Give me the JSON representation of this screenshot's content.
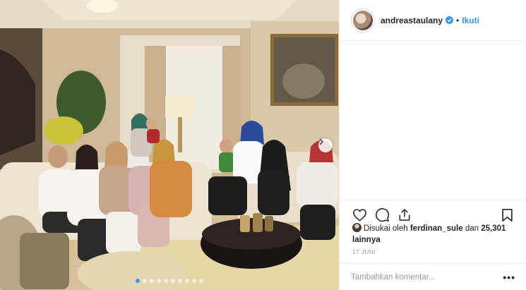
{
  "post": {
    "photo_alt": "Family gathering in living room",
    "carousel": {
      "count": 10,
      "active_index": 0
    }
  },
  "header": {
    "username": "andreastaulany",
    "separator": "•",
    "follow_label": "Ikuti",
    "verified_icon": "verified-badge-icon"
  },
  "actions": {
    "like_icon": "heart-icon",
    "comment_icon": "comment-icon",
    "share_icon": "share-icon",
    "save_icon": "bookmark-icon"
  },
  "likes": {
    "prefix": "Disukai oleh ",
    "liker": "ferdinan_sule",
    "middle": " dan ",
    "count": "25,301",
    "suffix": " lainnya"
  },
  "date": "17 JUNI",
  "comment": {
    "placeholder": "Tambahkan komentar...",
    "more_label": "•••"
  },
  "colors": {
    "accent": "#3897f0",
    "text": "#262626",
    "muted": "#999999",
    "border": "#efefef"
  }
}
